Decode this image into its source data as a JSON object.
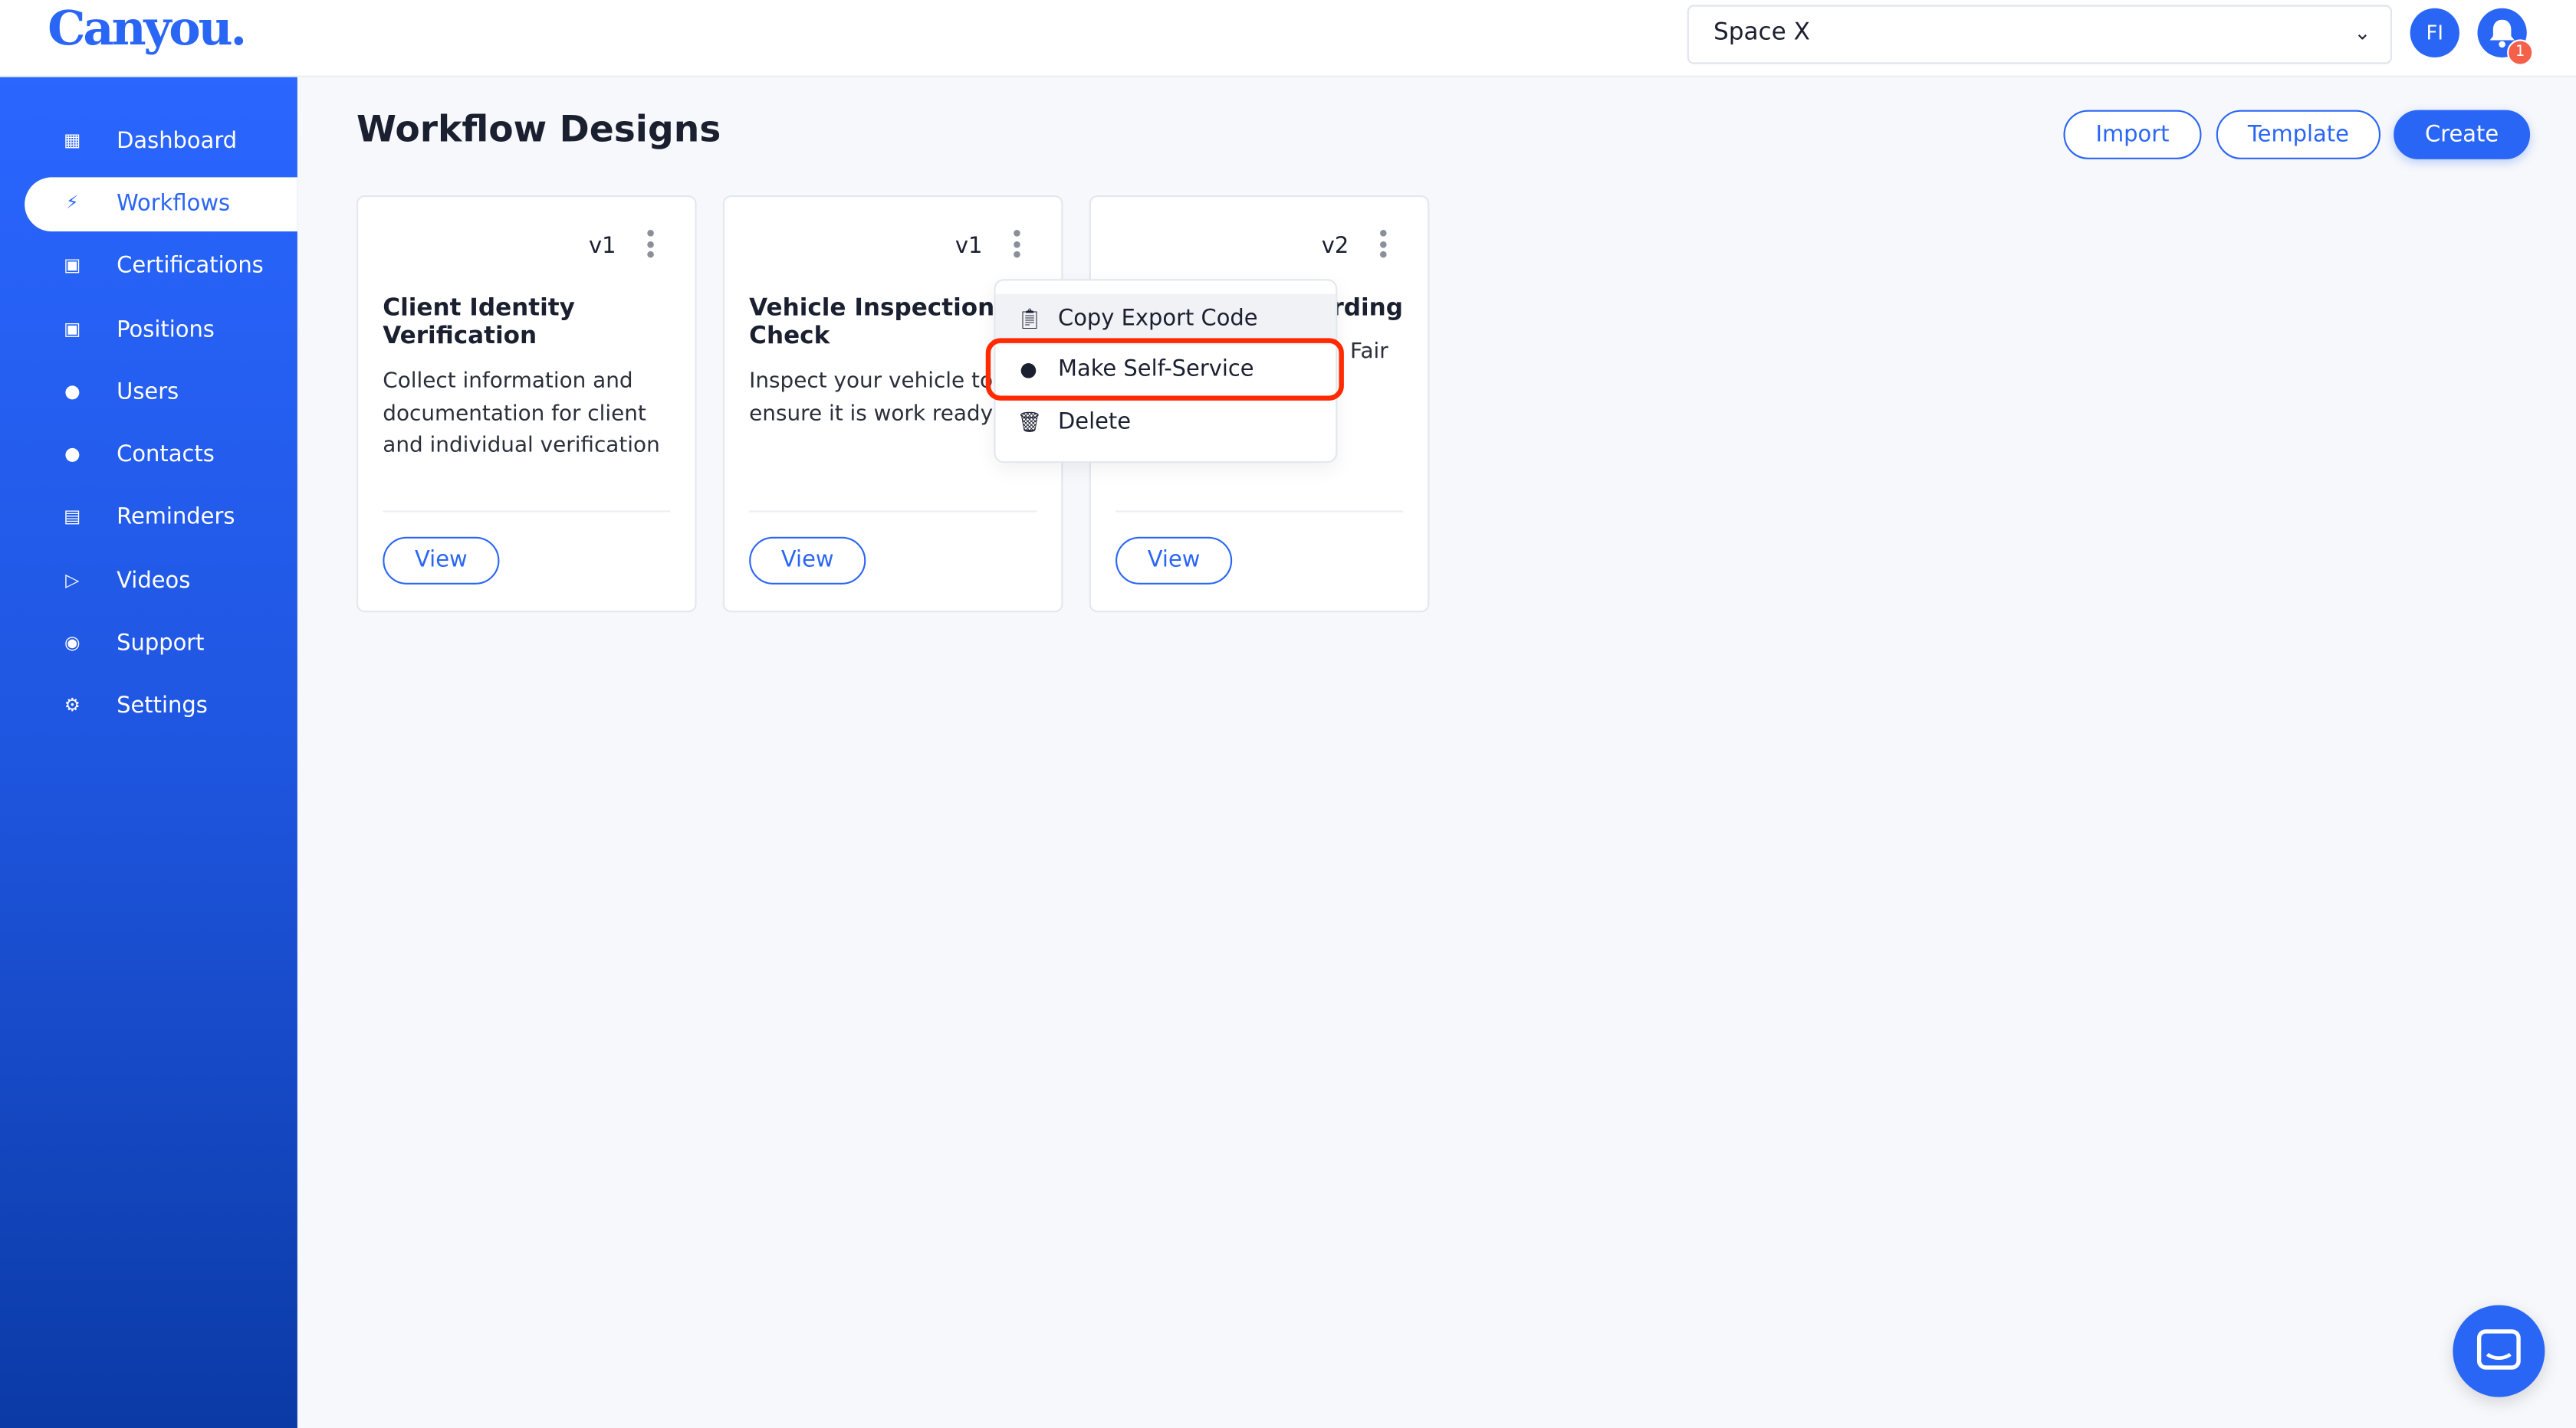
{
  "header": {
    "logo": "Canyou.",
    "space_select": "Space X",
    "avatar_initials": "FI",
    "notification_count": "1"
  },
  "sidebar": {
    "items": [
      {
        "label": "Dashboard",
        "icon": "dashboard-icon"
      },
      {
        "label": "Workflows",
        "icon": "lightning-icon",
        "active": true
      },
      {
        "label": "Certifications",
        "icon": "briefcase-icon"
      },
      {
        "label": "Positions",
        "icon": "briefcase-icon"
      },
      {
        "label": "Users",
        "icon": "user-icon"
      },
      {
        "label": "Contacts",
        "icon": "user-icon"
      },
      {
        "label": "Reminders",
        "icon": "calendar-icon"
      },
      {
        "label": "Videos",
        "icon": "video-icon"
      },
      {
        "label": "Support",
        "icon": "support-icon"
      },
      {
        "label": "Settings",
        "icon": "gear-icon"
      }
    ]
  },
  "main": {
    "title": "Workflow Designs",
    "import_label": "Import",
    "template_label": "Template",
    "create_label": "Create",
    "cards": [
      {
        "version": "v1",
        "title": "Client Identity Verification",
        "description": "Collect information and documentation for client and individual verification",
        "view_label": "View"
      },
      {
        "version": "v1",
        "title": "Vehicle Inspection Check",
        "description": "Inspect your vehicle to ensure it is work ready",
        "view_label": "View"
      },
      {
        "version": "v2",
        "title": "rding",
        "description": "Fair",
        "view_label": "View"
      }
    ]
  },
  "context_menu": {
    "items": [
      {
        "label": "Copy Export Code",
        "icon": "clipboard-icon"
      },
      {
        "label": "Make Self-Service",
        "icon": "user-check-icon",
        "highlighted": true
      },
      {
        "label": "Delete",
        "icon": "trash-icon"
      }
    ]
  },
  "colors": {
    "accent": "#2a66f5",
    "highlight": "#ff2a00",
    "badge": "#f5604a"
  }
}
